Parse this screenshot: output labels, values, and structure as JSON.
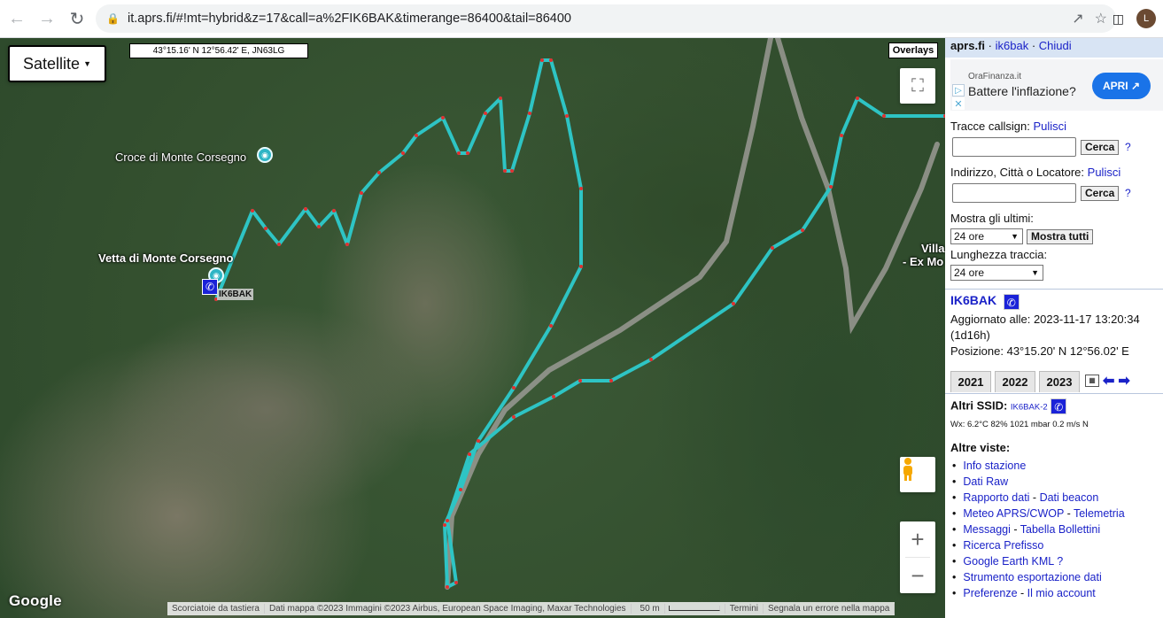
{
  "browser": {
    "url": "it.aprs.fi/#!mt=hybrid&z=17&call=a%2FIK6BAK&timerange=86400&tail=86400",
    "avatar_letter": "L",
    "icons": [
      "back-icon",
      "forward-icon",
      "reload-icon",
      "lock-icon",
      "share-icon",
      "star-icon",
      "sidebar-icon"
    ]
  },
  "map": {
    "maptype_label": "Satellite",
    "coords_readout": "43°15.16' N 12°56.42' E, JN63LG",
    "overlays_label": "Overlays",
    "labels": {
      "croce": "Croce di Monte Corsegno",
      "vetta": "Vetta di Monte Corsegno",
      "villa_1": "Villa",
      "villa_2": "- Ex Mo"
    },
    "station_label": "IK6BAK",
    "google": "Google",
    "attribution": {
      "shortcuts": "Scorciatoie da tastiera",
      "data": "Dati mappa ©2023 Immagini ©2023 Airbus, European Space Imaging, Maxar Technologies",
      "scale": "50 m",
      "terms": "Termini",
      "report": "Segnala un errore nella mappa"
    },
    "track_color": "#2ec4c4",
    "road_color": "#9a9a94"
  },
  "panel": {
    "brand": "aprs.fi",
    "sep1": "·",
    "call_link": "ik6bak",
    "sep2": "·",
    "close_link": "Chiudi",
    "ad": {
      "source": "OraFinanza.it",
      "headline": "Battere l'inflazione?",
      "button": "APRI ↗"
    },
    "track_label": "Tracce callsign:",
    "clear_1": "Pulisci",
    "search_1": "Cerca",
    "help_1": "?",
    "address_label": "Indirizzo, Città o Locatore:",
    "clear_2": "Pulisci",
    "search_2": "Cerca",
    "help_2": "?",
    "show_last_label": "Mostra gli ultimi:",
    "show_last_value": "24 ore",
    "show_all": "Mostra tutti",
    "track_len_label": "Lunghezza traccia:",
    "track_len_value": "24 ore",
    "station": {
      "call": "IK6BAK",
      "updated": "Aggiornato alle: 2023-11-17 13:20:34",
      "age": "(1d16h)",
      "position": "Posizione: 43°15.20' N 12°56.02' E"
    },
    "years": [
      "2021",
      "2022",
      "2023"
    ],
    "other_ssid_label": "Altri SSID:",
    "other_ssid": "IK6BAK-2",
    "wx": "Wx: 6.2°C 82% 1021 mbar 0.2 m/s N",
    "views_title": "Altre viste:",
    "views": [
      {
        "a": "Info stazione"
      },
      {
        "a": "Dati Raw"
      },
      {
        "a": "Rapporto dati",
        "sep": " - ",
        "b": "Dati beacon"
      },
      {
        "a": "Meteo APRS/CWOP",
        "sep": " - ",
        "b": "Telemetria"
      },
      {
        "a": "Messaggi",
        "sep": " - ",
        "b": "Tabella Bollettini"
      },
      {
        "a": "Ricerca Prefisso"
      },
      {
        "a": "Google Earth KML",
        "sep": " ",
        "b": "?"
      },
      {
        "a": "Strumento esportazione dati"
      },
      {
        "a": "Preferenze",
        "sep": " - ",
        "b": "Il mio account"
      }
    ]
  }
}
